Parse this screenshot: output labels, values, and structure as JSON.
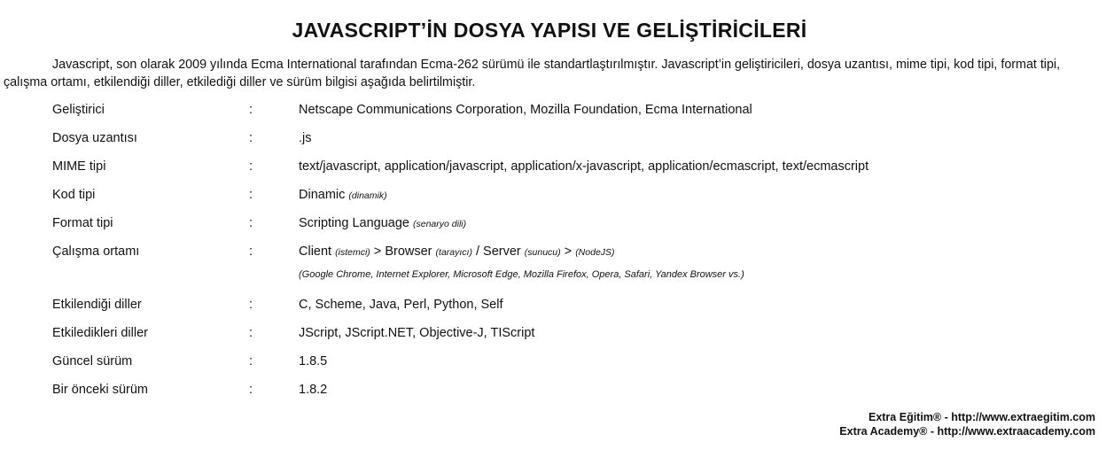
{
  "title": "JAVASCRIPT’İN DOSYA YAPISI VE GELİŞTİRİCİLERİ",
  "intro": "Javascript, son olarak 2009 yılında Ecma International tarafından Ecma-262 sürümü ile standartlaştırılmıştır. Javascript’in geliştiricileri, dosya uzantısı, mime tipi, kod tipi, format tipi, çalışma ortamı, etkilendiği diller, etkilediği diller ve sürüm bilgisi aşağıda belirtilmiştir.",
  "separator": ":",
  "rows": {
    "developer": {
      "label": "Geliştirici",
      "value": "Netscape Communications Corporation, Mozilla Foundation, Ecma International"
    },
    "extension": {
      "label": "Dosya uzantısı",
      "value": ".js"
    },
    "mime": {
      "label": "MIME tipi",
      "value": "text/javascript, application/javascript, application/x-javascript, application/ecmascript, text/ecmascript"
    },
    "code_type": {
      "label": "Kod tipi",
      "value": "Dinamic",
      "note": "(dinamik)"
    },
    "format_type": {
      "label": "Format tipi",
      "value": "Scripting Language",
      "note": "(senaryo dili)"
    },
    "runtime": {
      "label": "Çalışma ortamı",
      "client": "Client",
      "client_note": "(istemci)",
      "arrow1": " > ",
      "browser": "Browser",
      "browser_note": "(tarayıcı)",
      "slash": " / ",
      "server": "Server",
      "server_note": "(sunucu)",
      "arrow2": " > ",
      "node_note": "(NodeJS)",
      "browsers_list": "(Google Chrome, Internet Explorer, Microsoft Edge, Mozilla Firefox, Opera, Safari, Yandex Browser vs.)"
    },
    "influenced_by": {
      "label": "Etkilendiği diller",
      "value": "C, Scheme, Java, Perl, Python, Self"
    },
    "influenced": {
      "label": "Etkiledikleri diller",
      "value": "JScript, JScript.NET, Objective-J, TIScript"
    },
    "current_version": {
      "label": "Güncel sürüm",
      "value": "1.8.5"
    },
    "previous_version": {
      "label": "Bir önceki sürüm",
      "value": "1.8.2"
    }
  },
  "footer": {
    "line1": "Extra Eğitim® - http://www.extraegitim.com",
    "line2": "Extra Academy® - http://www.extraacademy.com"
  }
}
